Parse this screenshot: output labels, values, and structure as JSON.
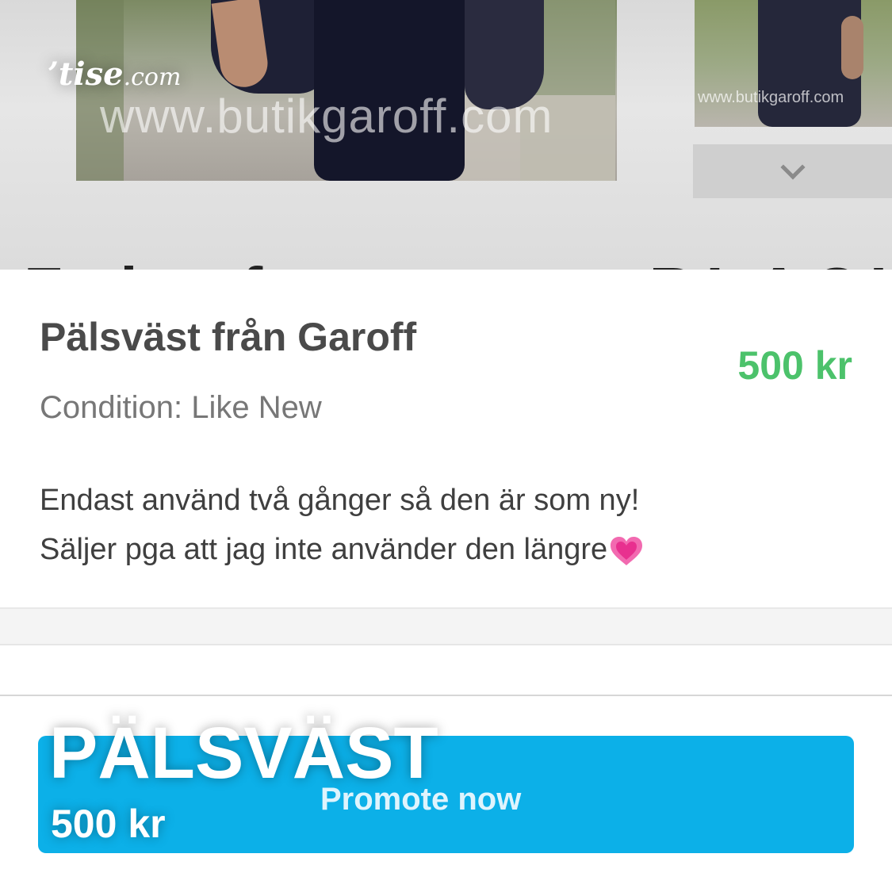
{
  "gallery": {
    "watermark_main": "www.butikgaroff.com",
    "watermark_thumb": "www.butikgaroff.com",
    "more_icon": "chevron-down-icon"
  },
  "brand": {
    "logo_main": "’tise",
    "logo_suffix": ".com"
  },
  "cut_heading": "Faka fur vest - BLACK",
  "listing": {
    "title": "Pälsväst från Garoff",
    "price": "500 kr",
    "condition": "Condition: Like New",
    "description_line1": "Endast använd två gånger så den är som ny!",
    "description_line2": "Säljer pga att jag inte använder den längre",
    "description_emoji": "growing-heart-icon",
    "price_color": "#4cc26b"
  },
  "promote": {
    "label": "Promote now",
    "color": "#0cb0e8"
  },
  "overlay": {
    "title": "PÄLSVÄST",
    "price": "500 kr"
  }
}
